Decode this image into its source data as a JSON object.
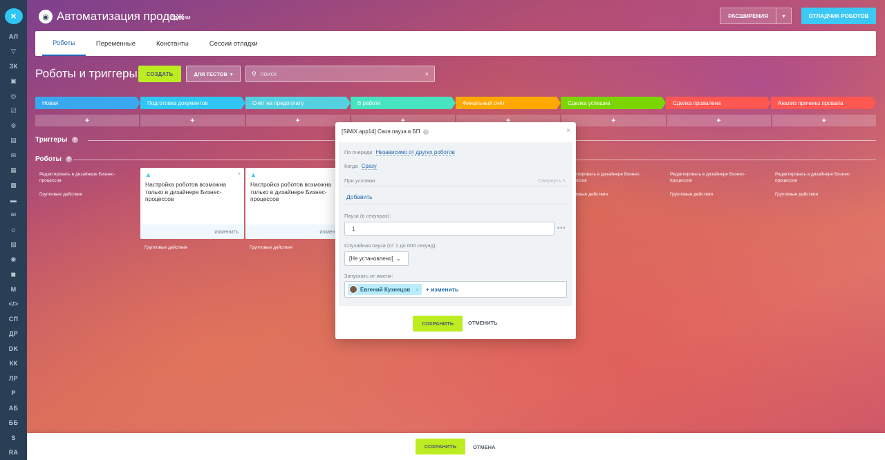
{
  "rail": {
    "close": "×",
    "items": [
      {
        "label": "АЛ",
        "icon": ""
      },
      {
        "label": "",
        "icon": "filter-icon"
      },
      {
        "label": "ЗК",
        "icon": ""
      },
      {
        "label": "",
        "icon": "cart-icon"
      },
      {
        "label": "",
        "icon": "target-icon"
      },
      {
        "label": "",
        "icon": "checkbox-icon"
      },
      {
        "label": "",
        "icon": "gear-icon"
      },
      {
        "label": "",
        "icon": "doc-icon"
      },
      {
        "label": "",
        "icon": "chat-icon"
      },
      {
        "label": "",
        "icon": "calendar-icon"
      },
      {
        "label": "",
        "icon": "file-icon"
      },
      {
        "label": "",
        "icon": "drive-icon"
      },
      {
        "label": "",
        "icon": "mail-icon"
      },
      {
        "label": "",
        "icon": "group-icon"
      },
      {
        "label": "",
        "icon": "contact-icon"
      },
      {
        "label": "",
        "icon": "robot-icon"
      },
      {
        "label": "",
        "icon": "box-icon"
      },
      {
        "label": "M",
        "icon": ""
      },
      {
        "label": "</>",
        "icon": ""
      },
      {
        "label": "СП",
        "icon": ""
      },
      {
        "label": "ДР",
        "icon": ""
      },
      {
        "label": "DK",
        "icon": ""
      },
      {
        "label": "КК",
        "icon": ""
      },
      {
        "label": "ЛР",
        "icon": ""
      },
      {
        "label": "Р",
        "icon": ""
      },
      {
        "label": "АБ",
        "icon": ""
      },
      {
        "label": "ББ",
        "icon": ""
      },
      {
        "label": "S",
        "icon": ""
      },
      {
        "label": "RA",
        "icon": ""
      }
    ]
  },
  "header": {
    "title": "Автоматизация продаж",
    "subtitle": "Сделки",
    "extensions": "РАСШИРЕНИЯ",
    "debugger": "ОТЛАДЧИК РОБОТОВ"
  },
  "tabs": [
    {
      "label": "Роботы"
    },
    {
      "label": "Переменные"
    },
    {
      "label": "Константы"
    },
    {
      "label": "Сессии отладки"
    }
  ],
  "toolbar": {
    "title": "Роботы и триггеры",
    "create": "СОЗДАТЬ",
    "for_tests": "ДЛЯ ТЕСТОВ",
    "search_placeholder": "поиск"
  },
  "stages": [
    {
      "label": "Новая",
      "color": "#39a8ef"
    },
    {
      "label": "Подготовка документов",
      "color": "#2fc6f6"
    },
    {
      "label": "Счёт на предоплату",
      "color": "#55d0e0"
    },
    {
      "label": "В работе",
      "color": "#47e4c2"
    },
    {
      "label": "Финальный счёт",
      "color": "#ffa900"
    },
    {
      "label": "Сделка успешна",
      "color": "#7bd500"
    },
    {
      "label": "Сделка провалена",
      "color": "#ff5752"
    },
    {
      "label": "Анализ причины провала",
      "color": "#ff5752"
    }
  ],
  "rows": {
    "triggers": "Триггеры",
    "robots": "Роботы",
    "plus": "+"
  },
  "columns": {
    "edit_link": "Редактировать в дизайнере Бизнес-процессов",
    "group_actions": "Групповые действия"
  },
  "robot_card": {
    "text": "Настройка роботов возможна только в дизайнере Бизнес-процессов",
    "change": "изменить"
  },
  "modal": {
    "title": "[SiMiX.app14] Своя пауза в БП",
    "queue_label": "По очереди",
    "queue_value": "Независимо от других роботов",
    "when_label": "Когда",
    "when_value": "Сразу",
    "condition_label": "При условии",
    "collapse": "Свернуть",
    "add": "Добавить",
    "pause_label": "Пауза (в секундах):",
    "pause_value": "1",
    "random_label": "Случайная пауза (от 1 до 600 секунд):",
    "random_value": "[Не установлено]",
    "run_as_label": "Запускать от имени:",
    "user": "Евгений Кузнецов",
    "change": "+ изменить",
    "save": "СОХРАНИТЬ",
    "cancel": "ОТМЕНИТЬ"
  },
  "bottom": {
    "save": "СОХРАНИТЬ",
    "cancel": "ОТМЕНА"
  }
}
